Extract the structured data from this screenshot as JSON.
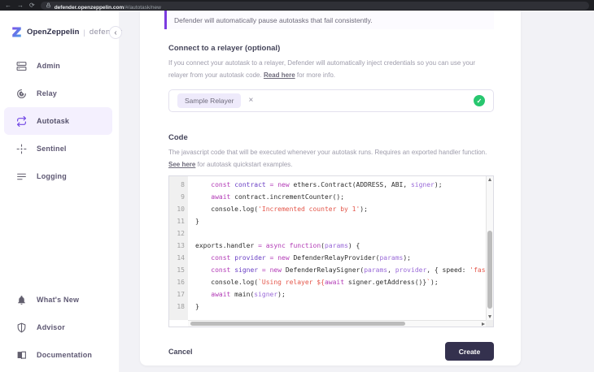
{
  "browser": {
    "url_domain": "defender.openzeppelin.com",
    "url_path": "/#/autotask/new"
  },
  "sidebar": {
    "logo_text": "OpenZeppelin",
    "logo_divider": "|",
    "logo_suffix": "defender",
    "collapse_glyph": "‹",
    "items": [
      {
        "label": "Admin"
      },
      {
        "label": "Relay"
      },
      {
        "label": "Autotask",
        "active": true
      },
      {
        "label": "Sentinel"
      },
      {
        "label": "Logging"
      }
    ],
    "footer_items": [
      {
        "label": "What's New"
      },
      {
        "label": "Advisor"
      },
      {
        "label": "Documentation"
      }
    ]
  },
  "main": {
    "alert_text": "Defender will automatically pause autotasks that fail consistently.",
    "relayer_section": {
      "title": "Connect to a relayer (optional)",
      "desc_before": "If you connect your autotask to a relayer, Defender will automatically inject credentials so you can use your relayer from your autotask code. ",
      "desc_link": "Read here",
      "desc_after": " for more info.",
      "selected_relayer": "Sample Relayer",
      "remove_glyph": "×",
      "valid_glyph": "✓"
    },
    "code_section": {
      "title": "Code",
      "desc_before": "The javascript code that will be executed whenever your autotask runs. Requires an exported handler function. ",
      "desc_link": "See here",
      "desc_after": " for autotask quickstart examples."
    },
    "footer": {
      "cancel_label": "Cancel",
      "create_label": "Create"
    }
  },
  "code_editor": {
    "lines": [
      {
        "num": 8,
        "tokens": [
          {
            "t": "    ",
            "c": "d"
          },
          {
            "t": "const",
            "c": "k"
          },
          {
            "t": " ",
            "c": "d"
          },
          {
            "t": "contract",
            "c": "v"
          },
          {
            "t": " ",
            "c": "d"
          },
          {
            "t": "=",
            "c": "k"
          },
          {
            "t": " ",
            "c": "d"
          },
          {
            "t": "new",
            "c": "k"
          },
          {
            "t": " ethers.Contract(ADDRESS, ABI, ",
            "c": "d"
          },
          {
            "t": "signer",
            "c": "p"
          },
          {
            "t": ");",
            "c": "d"
          }
        ]
      },
      {
        "num": 9,
        "tokens": [
          {
            "t": "    ",
            "c": "d"
          },
          {
            "t": "await",
            "c": "k"
          },
          {
            "t": " contract.incrementCounter();",
            "c": "d"
          }
        ]
      },
      {
        "num": 10,
        "tokens": [
          {
            "t": "    console.log(",
            "c": "d"
          },
          {
            "t": "'Incremented counter by 1'",
            "c": "s"
          },
          {
            "t": ");",
            "c": "d"
          }
        ]
      },
      {
        "num": 11,
        "tokens": [
          {
            "t": "}",
            "c": "d"
          }
        ]
      },
      {
        "num": 12,
        "tokens": []
      },
      {
        "num": 13,
        "tokens": [
          {
            "t": "exports.handler ",
            "c": "d"
          },
          {
            "t": "=",
            "c": "k"
          },
          {
            "t": " ",
            "c": "d"
          },
          {
            "t": "async",
            "c": "k"
          },
          {
            "t": " ",
            "c": "d"
          },
          {
            "t": "function",
            "c": "k"
          },
          {
            "t": "(",
            "c": "d"
          },
          {
            "t": "params",
            "c": "p"
          },
          {
            "t": ") {",
            "c": "d"
          }
        ]
      },
      {
        "num": 14,
        "tokens": [
          {
            "t": "    ",
            "c": "d"
          },
          {
            "t": "const",
            "c": "k"
          },
          {
            "t": " ",
            "c": "d"
          },
          {
            "t": "provider",
            "c": "v"
          },
          {
            "t": " ",
            "c": "d"
          },
          {
            "t": "=",
            "c": "k"
          },
          {
            "t": " ",
            "c": "d"
          },
          {
            "t": "new",
            "c": "k"
          },
          {
            "t": " DefenderRelayProvider(",
            "c": "d"
          },
          {
            "t": "params",
            "c": "p"
          },
          {
            "t": ");",
            "c": "d"
          }
        ]
      },
      {
        "num": 15,
        "tokens": [
          {
            "t": "    ",
            "c": "d"
          },
          {
            "t": "const",
            "c": "k"
          },
          {
            "t": " ",
            "c": "d"
          },
          {
            "t": "signer",
            "c": "v"
          },
          {
            "t": " ",
            "c": "d"
          },
          {
            "t": "=",
            "c": "k"
          },
          {
            "t": " ",
            "c": "d"
          },
          {
            "t": "new",
            "c": "k"
          },
          {
            "t": " DefenderRelaySigner(",
            "c": "d"
          },
          {
            "t": "params",
            "c": "p"
          },
          {
            "t": ", ",
            "c": "d"
          },
          {
            "t": "provider",
            "c": "p"
          },
          {
            "t": ", { speed: ",
            "c": "d"
          },
          {
            "t": "'fast' });",
            "c": "s"
          }
        ]
      },
      {
        "num": 16,
        "tokens": [
          {
            "t": "    console.log(",
            "c": "d"
          },
          {
            "t": "`Using relayer ${",
            "c": "s"
          },
          {
            "t": "await",
            "c": "k"
          },
          {
            "t": " signer.getAddress()}",
            "c": "d"
          },
          {
            "t": "`",
            "c": "s"
          },
          {
            "t": ");",
            "c": "d"
          }
        ]
      },
      {
        "num": 17,
        "tokens": [
          {
            "t": "    ",
            "c": "d"
          },
          {
            "t": "await",
            "c": "k"
          },
          {
            "t": " main(",
            "c": "d"
          },
          {
            "t": "signer",
            "c": "p"
          },
          {
            "t": ");",
            "c": "d"
          }
        ]
      },
      {
        "num": 18,
        "tokens": [
          {
            "t": "}",
            "c": "d"
          }
        ]
      }
    ]
  },
  "colors": {
    "accent_purple": "#7349e5",
    "success_green": "#28c76f",
    "primary_button": "#34314e",
    "code_keyword": "#b23ab6",
    "code_variable": "#6a3fc4",
    "code_param": "#9a6ad8",
    "code_string": "#e4574b"
  }
}
